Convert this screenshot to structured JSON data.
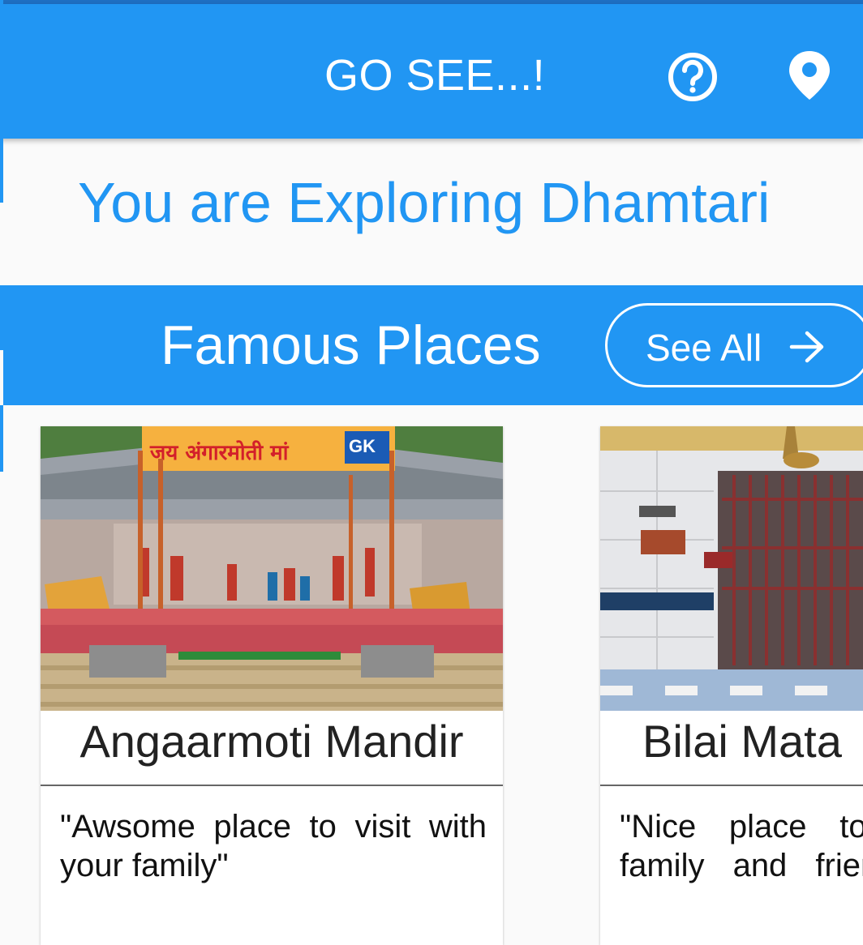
{
  "app_bar": {
    "title": "GO SEE...!",
    "help_icon": "help-circle-icon",
    "location_icon": "map-pin-icon"
  },
  "heading": {
    "text": "You are Exploring Dhamtari"
  },
  "section": {
    "title": "Famous Places",
    "see_all_label": "See All",
    "see_all_icon": "arrow-right-icon"
  },
  "places": [
    {
      "name": "Angaarmoti Mandir",
      "description": "\"Awsome place to visit with your family\"",
      "image_sign_text": "जय अंगारमोती मां",
      "image_logo_text": "GK"
    },
    {
      "name": "Bilai Mata",
      "description": "\"Nice place to visit with family and friends\""
    }
  ],
  "colors": {
    "primary": "#2196f3",
    "on_primary": "#ffffff",
    "background": "#fafafa",
    "card": "#ffffff"
  }
}
